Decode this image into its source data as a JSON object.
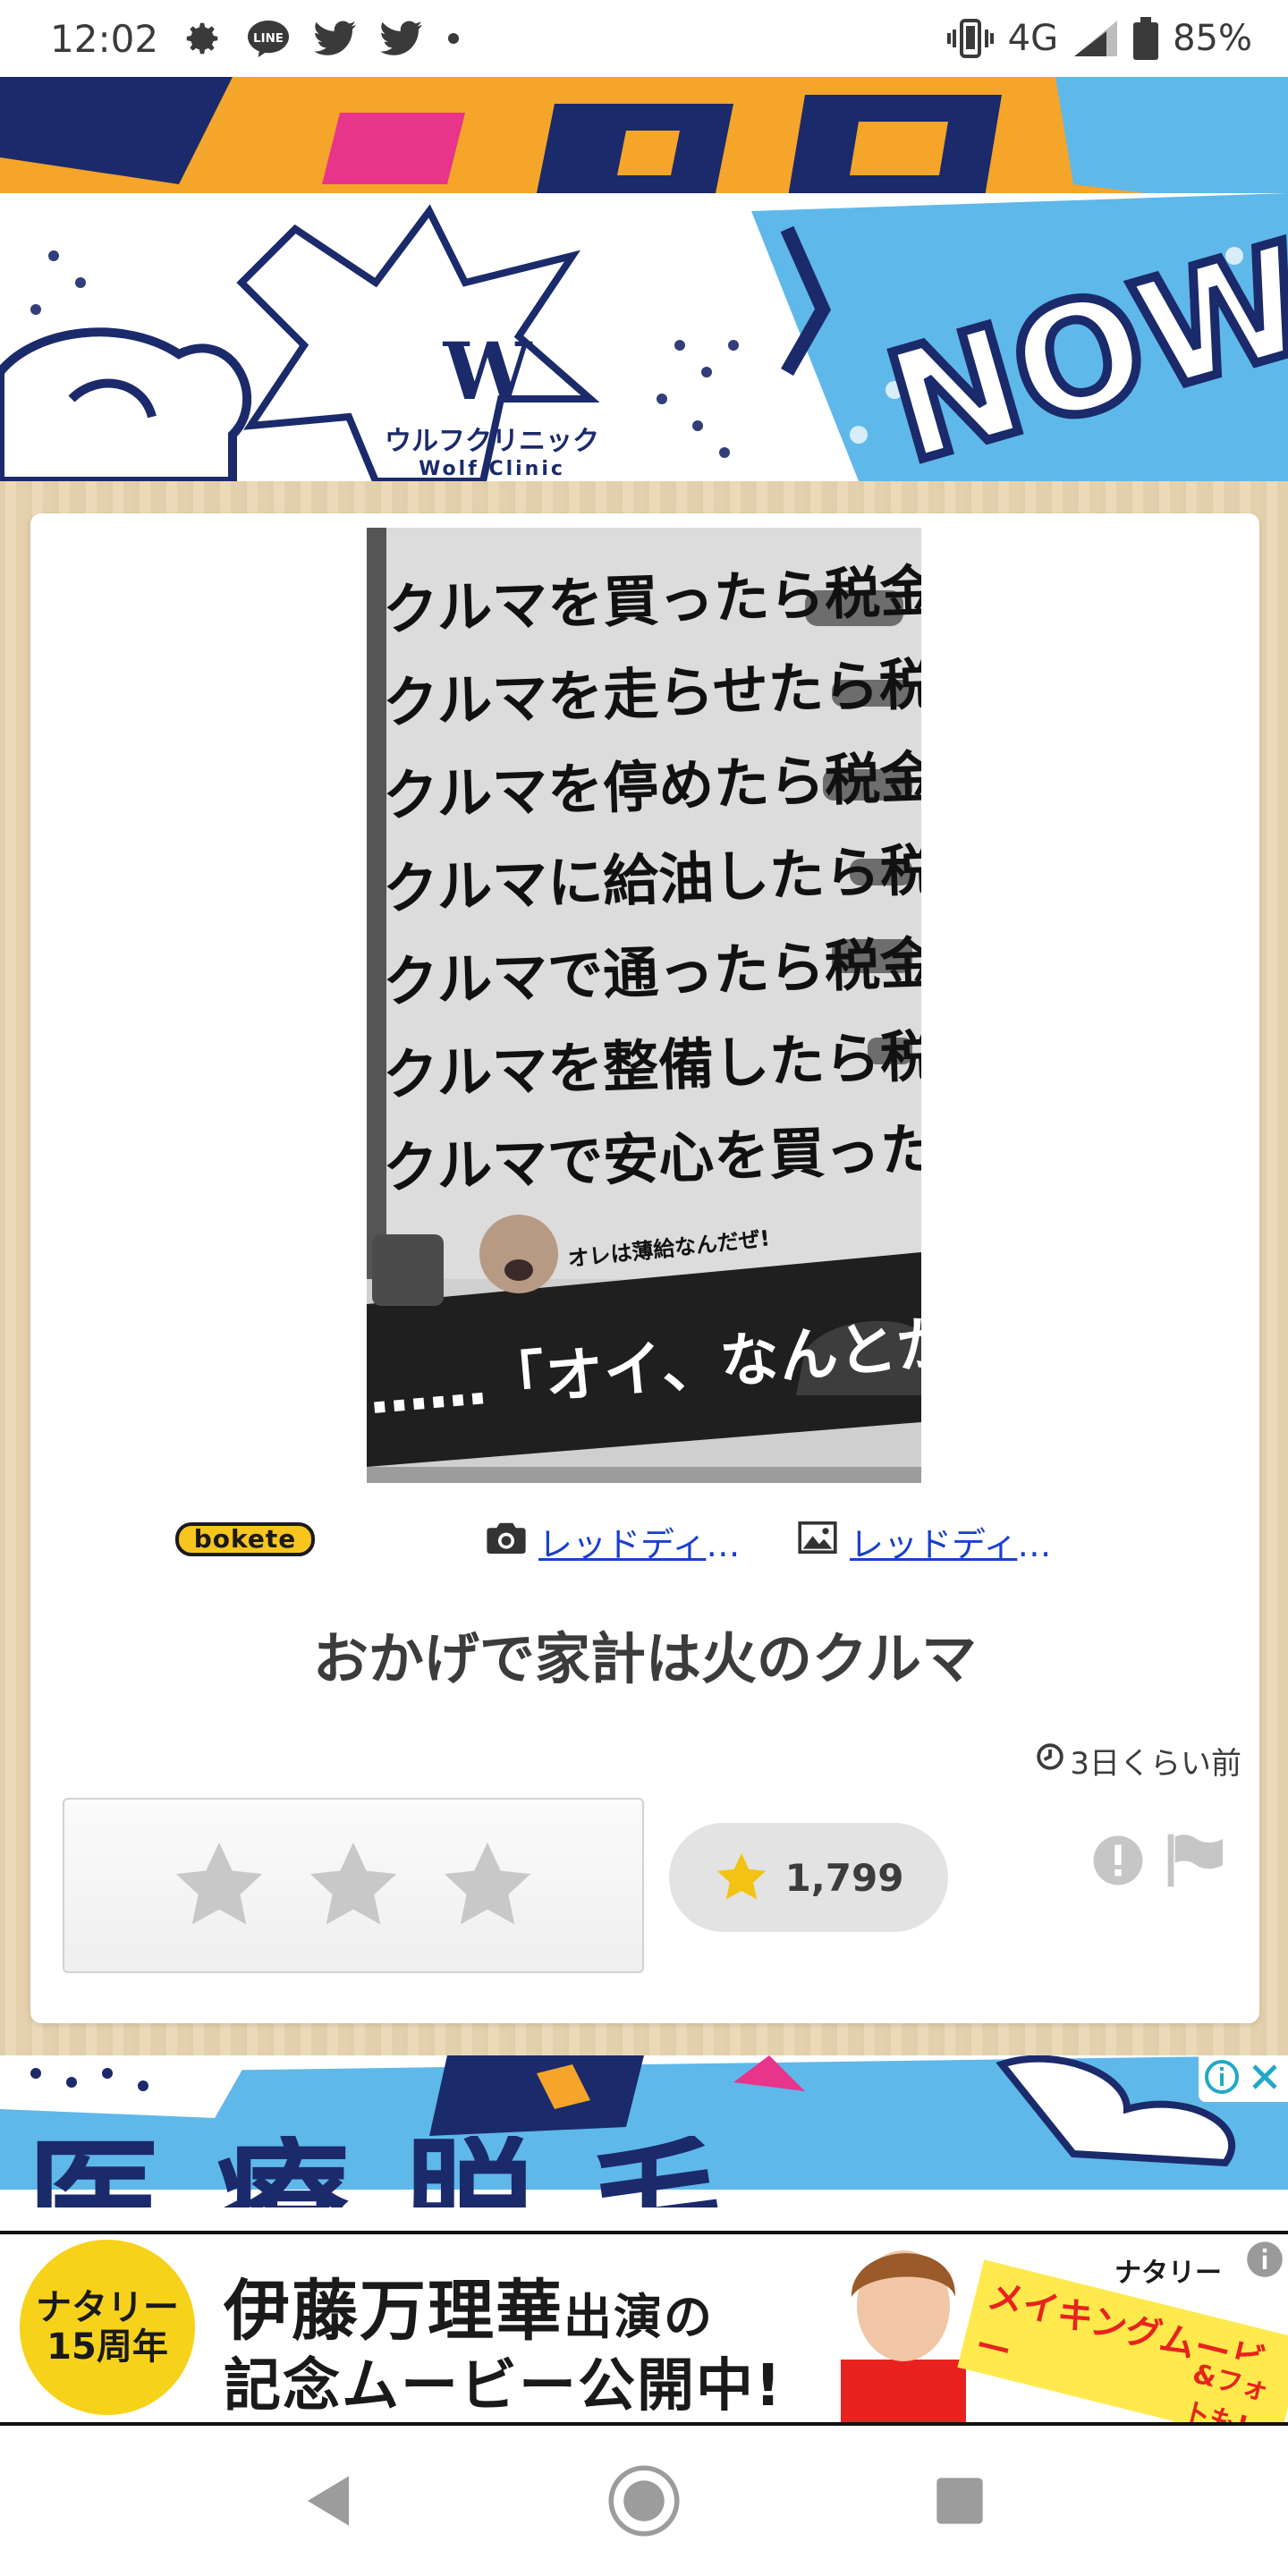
{
  "status_bar": {
    "time": "12:02",
    "network": "4G",
    "battery": "85%",
    "icons_left": [
      "gear-icon",
      "line-icon",
      "twitter-icon",
      "twitter-icon",
      "dot-icon"
    ],
    "icons_right": [
      "vibrate-icon",
      "signal-icon",
      "battery-icon"
    ]
  },
  "top_banner": {
    "logo_jp": "ウルフクリニック",
    "logo_en": "Wolf Clinic",
    "word": "NOW!"
  },
  "post": {
    "photo_lines": [
      "クルマを買ったら税金",
      "クルマを走らせたら税金",
      "クルマを停めたら税金",
      "クルマに給油したら税金",
      "クルマで通ったら税金",
      "クルマを整備したら税金",
      "クルマで安心を買ったら税"
    ],
    "photo_bubble": "オレは薄給なんだぜ!",
    "photo_bottom": "……「オイ、なんとかしろ",
    "site_logo": "bokete",
    "photo_credit": "レッドディザ…",
    "image_credit": "レッドディザ…",
    "caption": "おかげで家計は火のクルマ",
    "timestamp": "3日くらい前",
    "star_count": "1,799"
  },
  "ad_banner_1": {
    "text": "医療脱毛"
  },
  "ad_banner_2": {
    "anniv_line1": "ナタリー",
    "anniv_line2": "15周年",
    "headline_name": "伊藤万理華",
    "headline_suffix": "出演の",
    "subline": "記念ムービー公開中!",
    "tag": "メイキングムービー",
    "tag2": "&フォトも!",
    "brand": "ナタリー"
  },
  "colors": {
    "banner_navy": "#1b2a6b",
    "banner_orange": "#f4a52a",
    "banner_sky": "#5fb8ea",
    "link_blue": "#1a3fcf",
    "star_gold": "#f2c312",
    "star_grey": "#c8c8c8"
  }
}
